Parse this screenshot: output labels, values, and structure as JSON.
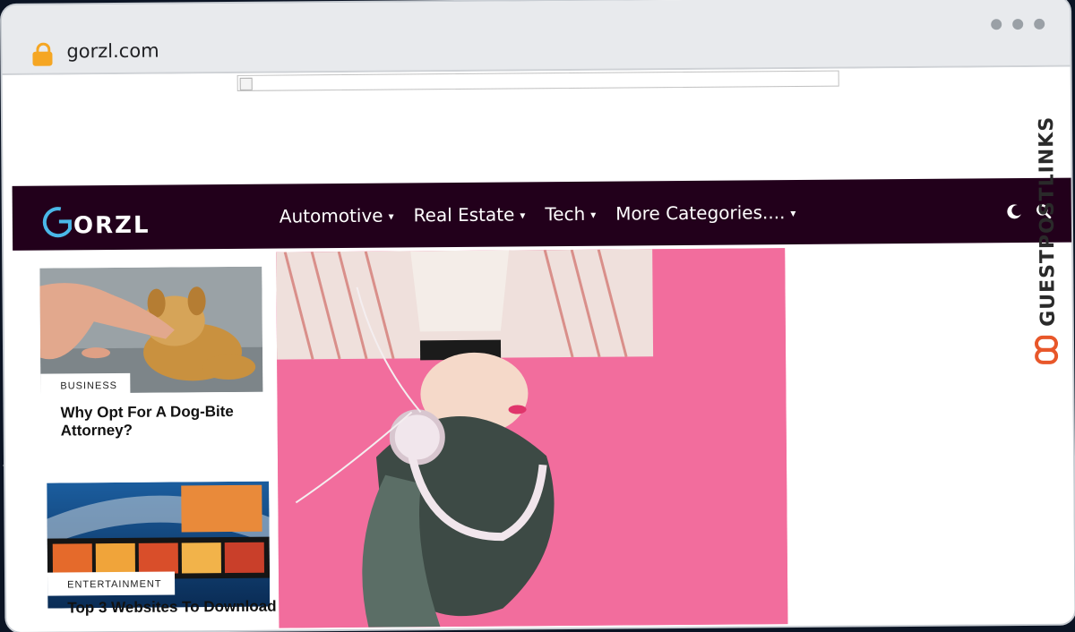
{
  "browser": {
    "url": "gorzl.com",
    "lock_icon": "lock-icon"
  },
  "site": {
    "logo_text": "GORZL",
    "nav": [
      {
        "label": "Automotive"
      },
      {
        "label": "Real Estate"
      },
      {
        "label": "Tech"
      },
      {
        "label": "More Categories...."
      }
    ],
    "icons": {
      "theme": "moon-icon",
      "search": "search-icon"
    }
  },
  "posts": [
    {
      "tag": "BUSINESS",
      "title": "Why Opt For A Dog-Bite Attorney?",
      "image": "dog-hand-photo"
    },
    {
      "tag": "ENTERTAINMENT",
      "title": "Top 3 Websites To Download",
      "image": "film-strip-sunset-photo"
    }
  ],
  "hero": {
    "image": "woman-headphones-pink-photo"
  },
  "watermark": {
    "text": "GUESTPOSTLINKS"
  },
  "colors": {
    "navbar": "#22001b",
    "accent_logo": "#4ab8e8",
    "watermark": "#e8572a"
  }
}
